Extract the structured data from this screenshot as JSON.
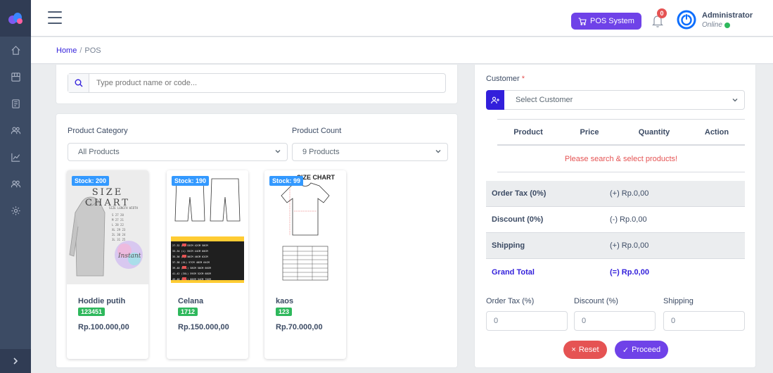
{
  "header": {
    "pos_button_label": "POS System",
    "notification_count": "0",
    "user_name": "Administrator",
    "user_status": "Online"
  },
  "breadcrumb": {
    "home": "Home",
    "separator": "/",
    "current": "POS"
  },
  "search": {
    "placeholder": "Type product name or code...",
    "value": ""
  },
  "filters": {
    "category_label": "Product Category",
    "category_value": "All Products",
    "count_label": "Product Count",
    "count_value": "9 Products"
  },
  "products": [
    {
      "stock": "Stock: 200",
      "name": "Hoddie putih",
      "code": "123451",
      "price": "Rp.100.000,00"
    },
    {
      "stock": "Stock: 190",
      "name": "Celana",
      "code": "1712",
      "price": "Rp.150.000,00"
    },
    {
      "stock": "Stock: 99",
      "name": "kaos",
      "code": "123",
      "price": "Rp.70.000,00"
    }
  ],
  "product_image_text": {
    "size_chart_title": "SIZE CHART",
    "tshirt_chart_title": "SIZE CHART"
  },
  "cart": {
    "customer_label": "Customer",
    "required_mark": "*",
    "customer_placeholder": "Select Customer",
    "columns": [
      "Product",
      "Price",
      "Quantity",
      "Action"
    ],
    "empty_message": "Please search & select products!"
  },
  "summary": [
    {
      "label": "Order Tax (0%)",
      "value": "(+) Rp.0,00"
    },
    {
      "label": "Discount (0%)",
      "value": "(-) Rp.0,00"
    },
    {
      "label": "Shipping",
      "value": "(+) Rp.0,00"
    },
    {
      "label": "Grand Total",
      "value": "(=) Rp.0,00"
    }
  ],
  "inputs": {
    "order_tax_label": "Order Tax (%)",
    "order_tax_value": "0",
    "discount_label": "Discount (%)",
    "discount_value": "0",
    "shipping_label": "Shipping",
    "shipping_value": "0"
  },
  "buttons": {
    "reset": "Reset",
    "proceed": "Proceed"
  },
  "colors": {
    "sidebar": "#3c4b64",
    "primary": "#321fdb",
    "pos_button": "#6f42e8",
    "danger": "#e55353",
    "success": "#2eb85c",
    "info": "#3399ff"
  }
}
